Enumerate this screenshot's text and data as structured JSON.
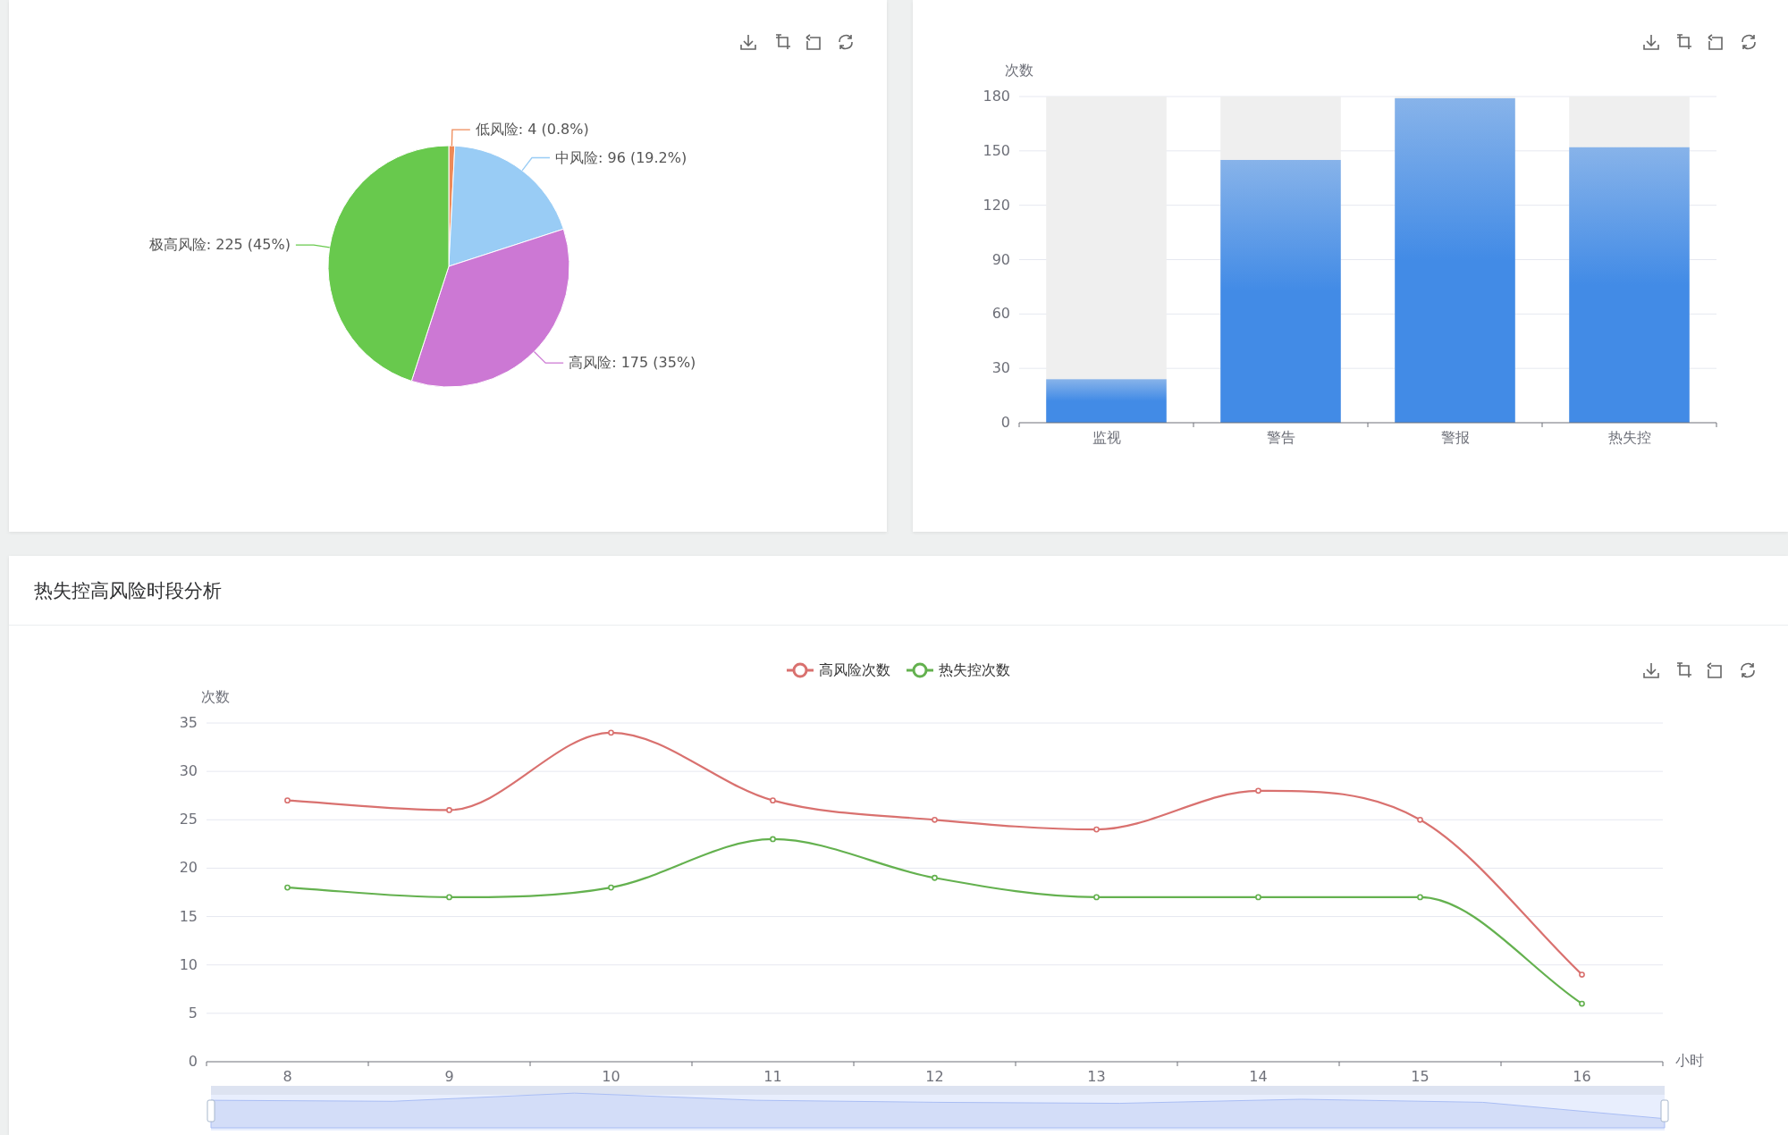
{
  "pie_panel": {
    "chart_data": {
      "type": "pie",
      "values": [
        4,
        96,
        175,
        225
      ],
      "value_labels": [
        "低风险: 4 (0.8%)",
        "中风险: 96 (19.2%)",
        "高风险: 175 (35%)",
        "极高风险: 225 (45%)"
      ]
    },
    "slices": [
      {
        "color": "#ee8a58"
      },
      {
        "color": "#99ccf5"
      },
      {
        "color": "#cc78d4"
      },
      {
        "color": "#68c94d"
      }
    ]
  },
  "bar_panel": {
    "chart_data": {
      "type": "bar",
      "ylabel": "次数",
      "categories": [
        "监视",
        "警告",
        "警报",
        "热失控"
      ],
      "series": [
        {
          "color": "#428be6",
          "values": [
            24,
            145,
            179,
            152
          ]
        }
      ],
      "ylim": [
        0,
        180
      ],
      "yticks": [
        0,
        30,
        60,
        90,
        120,
        150,
        180
      ],
      "grid": true
    }
  },
  "line_panel": {
    "title": "热失控高风险时段分析",
    "chart_data": {
      "type": "line",
      "xlabel": "小时",
      "ylabel": "次数",
      "categories": [
        "8",
        "9",
        "10",
        "11",
        "12",
        "13",
        "14",
        "15",
        "16"
      ],
      "series": [
        {
          "name": "高风险次数",
          "color": "#d9716f",
          "marker": "circle",
          "values": [
            27,
            26,
            34,
            27,
            25,
            24,
            28,
            25,
            9
          ]
        },
        {
          "name": "热失控次数",
          "color": "#64b14f",
          "marker": "circle",
          "values": [
            18,
            17,
            18,
            23,
            19,
            17,
            17,
            17,
            6
          ]
        }
      ],
      "ylim": [
        0,
        35
      ],
      "yticks": [
        0,
        5,
        10,
        15,
        20,
        25,
        30,
        35
      ],
      "grid": true,
      "legend": "top"
    }
  }
}
